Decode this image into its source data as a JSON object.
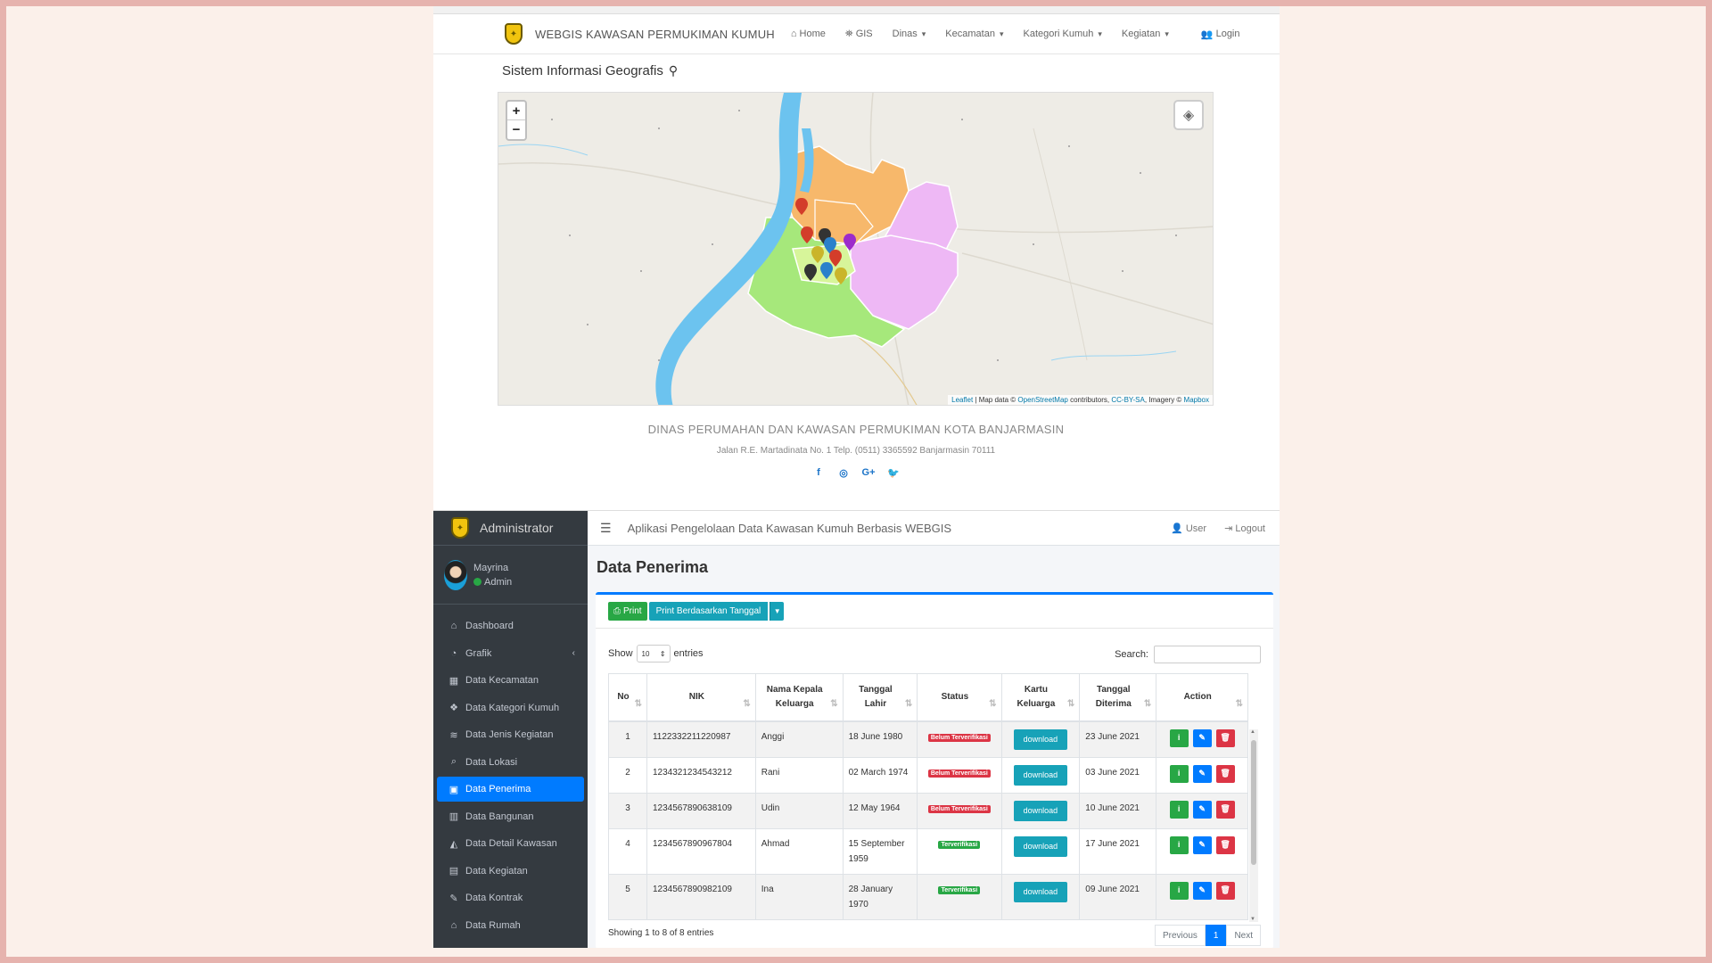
{
  "public": {
    "brand": "WEBGIS KAWASAN PERMUKIMAN KUMUH",
    "nav": [
      {
        "icon": "home-icon",
        "glyph": "⌂",
        "label": "Home"
      },
      {
        "icon": "gis-icon",
        "glyph": "⛯",
        "label": "GIS"
      },
      {
        "label": "Dinas"
      },
      {
        "label": "Kecamatan"
      },
      {
        "label": "Kategori Kumuh"
      },
      {
        "label": "Kegiatan"
      }
    ],
    "login_label": "Login",
    "page_title": "Sistem Informasi Geografis",
    "map": {
      "zoom_in": "+",
      "zoom_out": "−",
      "attr_leaflet": "Leaflet",
      "attr_text1": " | Map data © ",
      "attr_osm": "OpenStreetMap",
      "attr_text2": " contributors, ",
      "attr_cc": "CC-BY-SA",
      "attr_text3": ", Imagery © ",
      "attr_mapbox": "Mapbox",
      "colors": {
        "river": "#6cc3ef",
        "zone_orange": "#f7b86b",
        "zone_green": "#a6e87b",
        "zone_purple": "#eeb8f5",
        "zone_lime": "#d7f59a"
      }
    },
    "footer": {
      "org": "DINAS PERUMAHAN DAN KAWASAN PERMUKIMAN KOTA BANJARMASIN",
      "address": "Jalan R.E. Martadinata No. 1 Telp. (0511) 3365592 Banjarmasin 70111",
      "social": [
        "facebook-icon",
        "instagram-icon",
        "google-plus-icon",
        "twitter-icon"
      ]
    }
  },
  "admin": {
    "brand": "Administrator",
    "user": {
      "name": "Mayrina",
      "role": "Admin"
    },
    "menu": [
      {
        "icon": "home-icon",
        "glyph": "⌂",
        "label": "Dashboard"
      },
      {
        "icon": "chart-pie-icon",
        "glyph": "◔",
        "label": "Grafik"
      },
      {
        "icon": "map-icon",
        "glyph": "▦",
        "label": "Data Kecamatan"
      },
      {
        "icon": "cubes-icon",
        "glyph": "❖",
        "label": "Data Kategori Kumuh"
      },
      {
        "icon": "layers-icon",
        "glyph": "≋",
        "label": "Data Jenis Kegiatan"
      },
      {
        "icon": "search-location-icon",
        "glyph": "⌕",
        "label": "Data Lokasi"
      },
      {
        "icon": "id-card-icon",
        "glyph": "▣",
        "label": "Data Penerima"
      },
      {
        "icon": "building-icon",
        "glyph": "▥",
        "label": "Data Bangunan"
      },
      {
        "icon": "area-chart-icon",
        "glyph": "◭",
        "label": "Data Detail Kawasan"
      },
      {
        "icon": "calendar-icon",
        "glyph": "▤",
        "label": "Data Kegiatan"
      },
      {
        "icon": "file-signature-icon",
        "glyph": "✎",
        "label": "Data Kontrak"
      },
      {
        "icon": "home-icon",
        "glyph": "⌂",
        "label": "Data Rumah"
      }
    ],
    "app_title": "Aplikasi Pengelolaan Data Kawasan Kumuh Berbasis WEBGIS",
    "user_link": "User",
    "logout_link": "Logout",
    "page_title": "Data Penerima",
    "print_label": "Print",
    "print_date_label": "Print Berdasarkan Tanggal",
    "show_label": "Show",
    "entries_value": "10",
    "entries_label": "entries",
    "search_label": "Search:",
    "columns": [
      "No",
      "NIK",
      "Nama Kepala Keluarga",
      "Tanggal Lahir",
      "Status",
      "Kartu Keluarga",
      "Tanggal Diterima",
      "Action"
    ],
    "rows": [
      {
        "no": "1",
        "nik": "1122332211220987",
        "nama": "Anggi",
        "lahir": "18 June 1980",
        "status": "Belum Terverifikasi",
        "verified": false,
        "kk": "download",
        "diterima": "23 June 2021"
      },
      {
        "no": "2",
        "nik": "1234321234543212",
        "nama": "Rani",
        "lahir": "02 March 1974",
        "status": "Belum Terverifikasi",
        "verified": false,
        "kk": "download",
        "diterima": "03 June 2021"
      },
      {
        "no": "3",
        "nik": "1234567890638109",
        "nama": "Udin",
        "lahir": "12 May 1964",
        "status": "Belum Terverifikasi",
        "verified": false,
        "kk": "download",
        "diterima": "10 June 2021"
      },
      {
        "no": "4",
        "nik": "1234567890967804",
        "nama": "Ahmad",
        "lahir": "15 September 1959",
        "status": "Terverifikasi",
        "verified": true,
        "kk": "download",
        "diterima": "17 June 2021"
      },
      {
        "no": "5",
        "nik": "1234567890982109",
        "nama": "Ina",
        "lahir": "28 January 1970",
        "status": "Terverifikasi",
        "verified": true,
        "kk": "download",
        "diterima": "09 June 2021"
      }
    ],
    "info": "Showing 1 to 8 of 8 entries",
    "pager": {
      "prev": "Previous",
      "current": "1",
      "next": "Next"
    }
  }
}
